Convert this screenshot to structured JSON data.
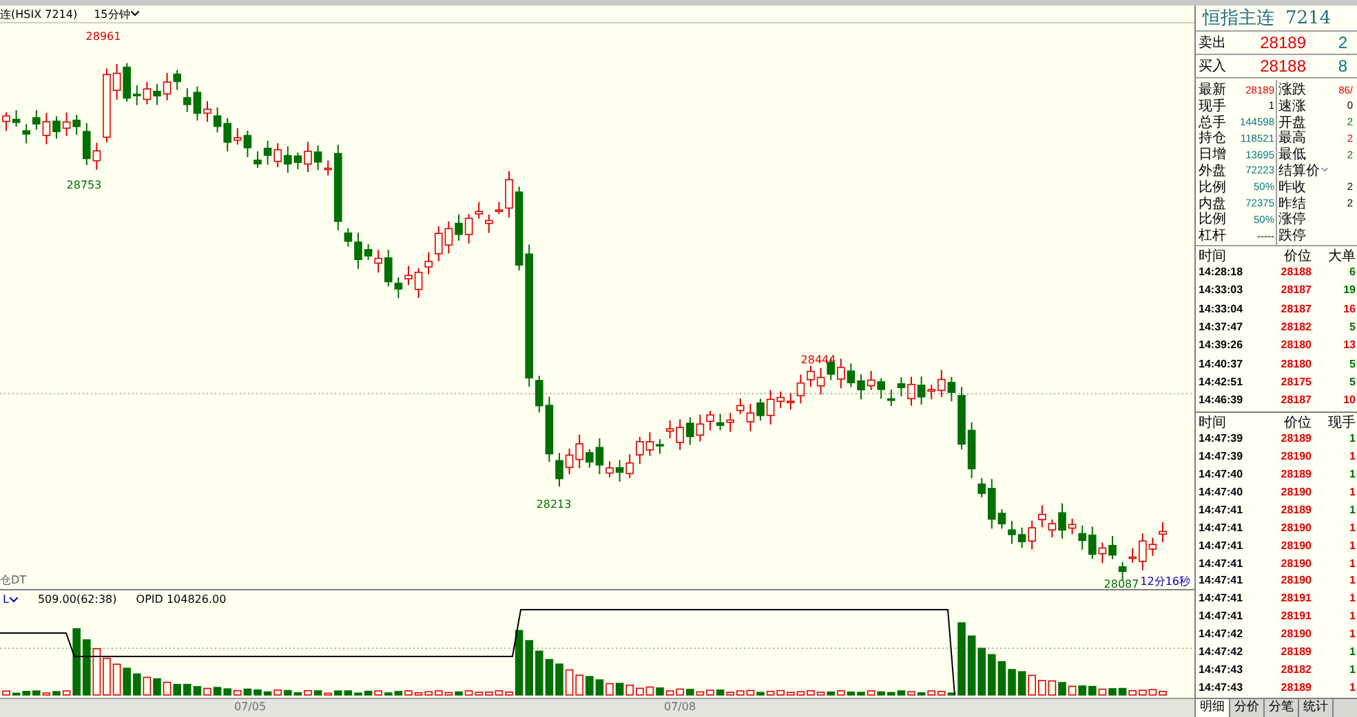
{
  "toolbar": {
    "symbol": "连(HSIX 7214)",
    "period": "15分钟"
  },
  "chart_labels": [
    {
      "text": "28961",
      "color": "#e00000"
    },
    {
      "text": "28753",
      "color": "#007000"
    },
    {
      "text": "28213",
      "color": "#007000"
    },
    {
      "text": "28444",
      "color": "#e00000"
    },
    {
      "text": "28087",
      "color": "#007000"
    }
  ],
  "chart_footer": {
    "left": "仓DT",
    "countdown": "12分16秒"
  },
  "indicator": {
    "name": "L",
    "reading": "509.00(62:38)",
    "opid": "OPID 104826.00"
  },
  "dates": [
    "07/05",
    "07/08"
  ],
  "quote": {
    "title": "恒指主连",
    "code": "7214",
    "ask": {
      "label": "卖出",
      "price": "28189",
      "size": "2"
    },
    "bid": {
      "label": "买入",
      "price": "28188",
      "size": "8"
    },
    "rows": [
      {
        "left": {
          "label": "最新",
          "value": "28189",
          "color": "#e00000"
        },
        "right": {
          "label": "涨跌",
          "value": "86/",
          "color": "#e00000"
        }
      },
      {
        "left": {
          "label": "现手",
          "value": "1",
          "color": "#000000"
        },
        "right": {
          "label": "速涨",
          "value": "0",
          "color": "#000000"
        }
      },
      {
        "left": {
          "label": "总手",
          "value": "144598",
          "color": "#007878"
        },
        "right": {
          "label": "开盘",
          "value": "2",
          "color": "#007000"
        }
      },
      {
        "left": {
          "label": "持仓",
          "value": "118521",
          "color": "#007878"
        },
        "right": {
          "label": "最高",
          "value": "2",
          "color": "#e00000"
        }
      },
      {
        "left": {
          "label": "日增",
          "value": "13695",
          "color": "#007878"
        },
        "right": {
          "label": "最低",
          "value": "2",
          "color": "#007000"
        }
      },
      {
        "left": {
          "label": "外盘",
          "value": "72223",
          "color": "#007878"
        },
        "right": {
          "label": "结算价",
          "dropdown": true
        }
      },
      {
        "left": {
          "label": "比例",
          "value": "50%",
          "color": "#007878"
        },
        "right": {
          "label": "昨收",
          "value": "2",
          "color": "#000000"
        }
      },
      {
        "left": {
          "label": "内盘",
          "value": "72375",
          "color": "#007878"
        },
        "right": {
          "label": "昨结",
          "value": "2",
          "color": "#000000"
        }
      },
      {
        "left": {
          "label": "比例",
          "value": "50%",
          "color": "#007878"
        },
        "right": {
          "label": "涨停"
        }
      },
      {
        "left": {
          "label": "杠杆",
          "value": "-----"
        },
        "right": {
          "label": "跌停"
        }
      }
    ]
  },
  "big_orders": {
    "columns": [
      "时间",
      "价位",
      "大单"
    ],
    "rows": [
      {
        "time": "14:28:18",
        "price": "28188",
        "size": "6",
        "color": "#007000"
      },
      {
        "time": "14:33:03",
        "price": "28187",
        "size": "19",
        "color": "#007000"
      },
      {
        "time": "14:33:04",
        "price": "28187",
        "size": "16",
        "color": "#e00000"
      },
      {
        "time": "14:37:47",
        "price": "28182",
        "size": "5",
        "color": "#007000"
      },
      {
        "time": "14:39:26",
        "price": "28180",
        "size": "13",
        "color": "#e00000"
      },
      {
        "time": "14:40:37",
        "price": "28180",
        "size": "5",
        "color": "#007000"
      },
      {
        "time": "14:42:51",
        "price": "28175",
        "size": "5",
        "color": "#007000"
      },
      {
        "time": "14:46:39",
        "price": "28187",
        "size": "10",
        "color": "#e00000"
      }
    ]
  },
  "ticks": {
    "columns": [
      "时间",
      "价位",
      "现手"
    ],
    "rows": [
      {
        "time": "14:47:39",
        "price": "28189",
        "size": "1",
        "color": "#007000"
      },
      {
        "time": "14:47:39",
        "price": "28190",
        "size": "1",
        "color": "#e00000"
      },
      {
        "time": "14:47:40",
        "price": "28189",
        "size": "1",
        "color": "#007000"
      },
      {
        "time": "14:47:40",
        "price": "28190",
        "size": "1",
        "color": "#e00000"
      },
      {
        "time": "14:47:41",
        "price": "28189",
        "size": "1",
        "color": "#007000"
      },
      {
        "time": "14:47:41",
        "price": "28190",
        "size": "1",
        "color": "#e00000"
      },
      {
        "time": "14:47:41",
        "price": "28190",
        "size": "1",
        "color": "#e00000"
      },
      {
        "time": "14:47:41",
        "price": "28190",
        "size": "1",
        "color": "#e00000"
      },
      {
        "time": "14:47:41",
        "price": "28190",
        "size": "1",
        "color": "#e00000"
      },
      {
        "time": "14:47:41",
        "price": "28191",
        "size": "1",
        "color": "#e00000"
      },
      {
        "time": "14:47:41",
        "price": "28191",
        "size": "1",
        "color": "#e00000"
      },
      {
        "time": "14:47:42",
        "price": "28190",
        "size": "1",
        "color": "#e00000"
      },
      {
        "time": "14:47:42",
        "price": "28189",
        "size": "1",
        "color": "#007000"
      },
      {
        "time": "14:47:43",
        "price": "28182",
        "size": "1",
        "color": "#007000"
      },
      {
        "time": "14:47:43",
        "price": "28189",
        "size": "1",
        "color": "#e00000"
      }
    ]
  },
  "tabs": [
    {
      "label": "明细",
      "selected": true
    },
    {
      "label": "分价",
      "selected": false
    },
    {
      "label": "分笔",
      "selected": false
    },
    {
      "label": "统计",
      "selected": false
    }
  ]
}
